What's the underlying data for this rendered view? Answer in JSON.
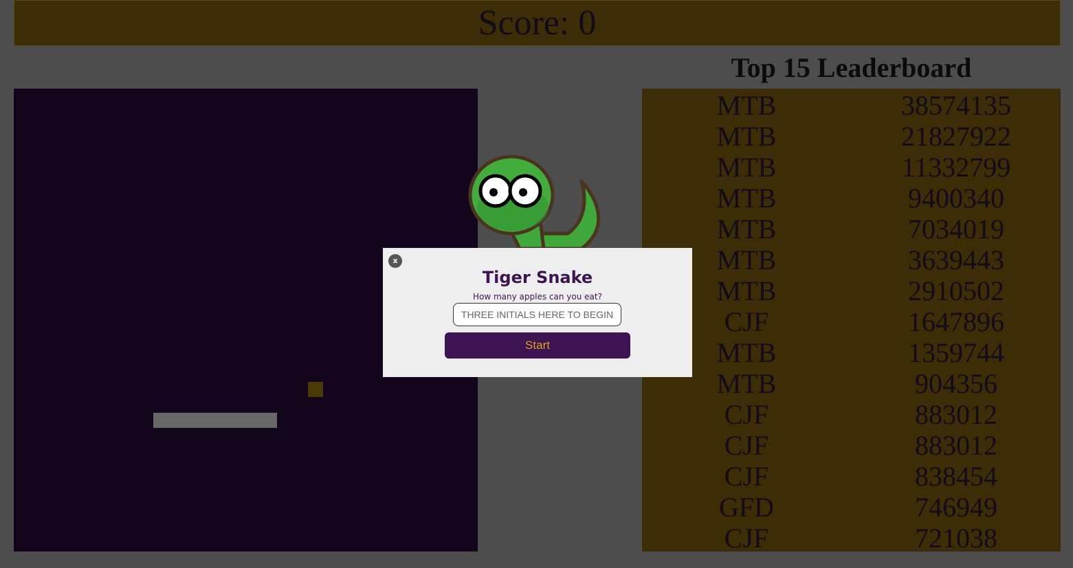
{
  "score": {
    "label": "Score: 0"
  },
  "leaderboard": {
    "title": "Top 15 Leaderboard",
    "entries": [
      {
        "name": "MTB",
        "score": "38574135"
      },
      {
        "name": "MTB",
        "score": "21827922"
      },
      {
        "name": "MTB",
        "score": "11332799"
      },
      {
        "name": "MTB",
        "score": "9400340"
      },
      {
        "name": "MTB",
        "score": "7034019"
      },
      {
        "name": "MTB",
        "score": "3639443"
      },
      {
        "name": "MTB",
        "score": "2910502"
      },
      {
        "name": "CJF",
        "score": "1647896"
      },
      {
        "name": "MTB",
        "score": "1359744"
      },
      {
        "name": "MTB",
        "score": "904356"
      },
      {
        "name": "CJF",
        "score": "883012"
      },
      {
        "name": "CJF",
        "score": "883012"
      },
      {
        "name": "CJF",
        "score": "838454"
      },
      {
        "name": "GFD",
        "score": "746949"
      },
      {
        "name": "CJF",
        "score": "721038"
      }
    ]
  },
  "modal": {
    "close_label": "x",
    "title": "Tiger Snake",
    "subtitle": "How many apples can you eat?",
    "input_value": "",
    "input_placeholder": "THREE INITIALS HERE TO BEGIN",
    "start_label": "Start"
  },
  "icons": {
    "mascot": "cartoon-snake-icon",
    "close": "close-icon"
  },
  "colors": {
    "page_bg": "#4d4d4d",
    "panel_gold": "#3c2d06",
    "board_bg": "#12051c",
    "snake": "#676767",
    "apple": "#4b3a08",
    "brand_purple": "#3d1452",
    "button_text_gold": "#d9a21a"
  }
}
